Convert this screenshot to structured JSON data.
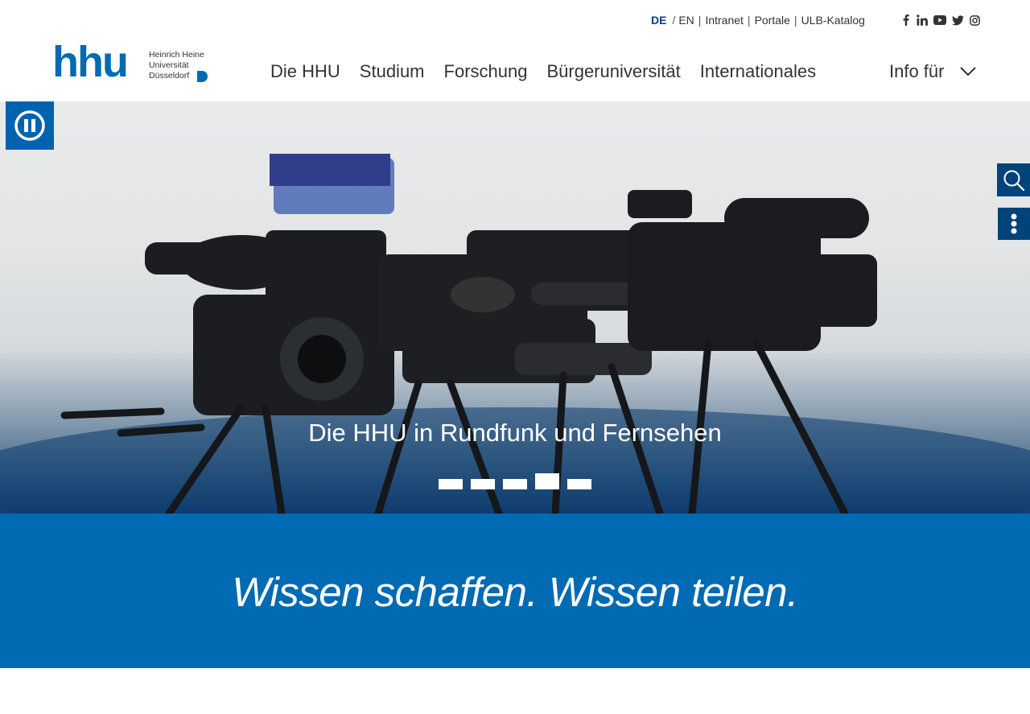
{
  "topbar": {
    "lang_de": "DE",
    "lang_sep": "/",
    "lang_en": "EN",
    "links": [
      "Intranet",
      "Portale",
      "ULB-Katalog"
    ],
    "link_sep": "|",
    "social_icons": [
      "facebook-icon",
      "linkedin-icon",
      "youtube-icon",
      "twitter-icon",
      "instagram-icon"
    ]
  },
  "logo": {
    "wordmark": "hhu",
    "line1": "Heinrich Heine",
    "line2": "Universität",
    "line3": "Düsseldorf"
  },
  "nav": {
    "items": [
      "Die HHU",
      "Studium",
      "Forschung",
      "Bürgeruniversität",
      "Internationales"
    ],
    "info_label": "Info für"
  },
  "hero": {
    "title": "Die HHU in Rundfunk und Fernsehen",
    "slide_count": 5,
    "active_slide": 4
  },
  "claim": {
    "text": "Wissen schaffen. Wissen teilen."
  },
  "colors": {
    "brand_blue": "#006ab3",
    "dark_blue": "#00437a"
  }
}
